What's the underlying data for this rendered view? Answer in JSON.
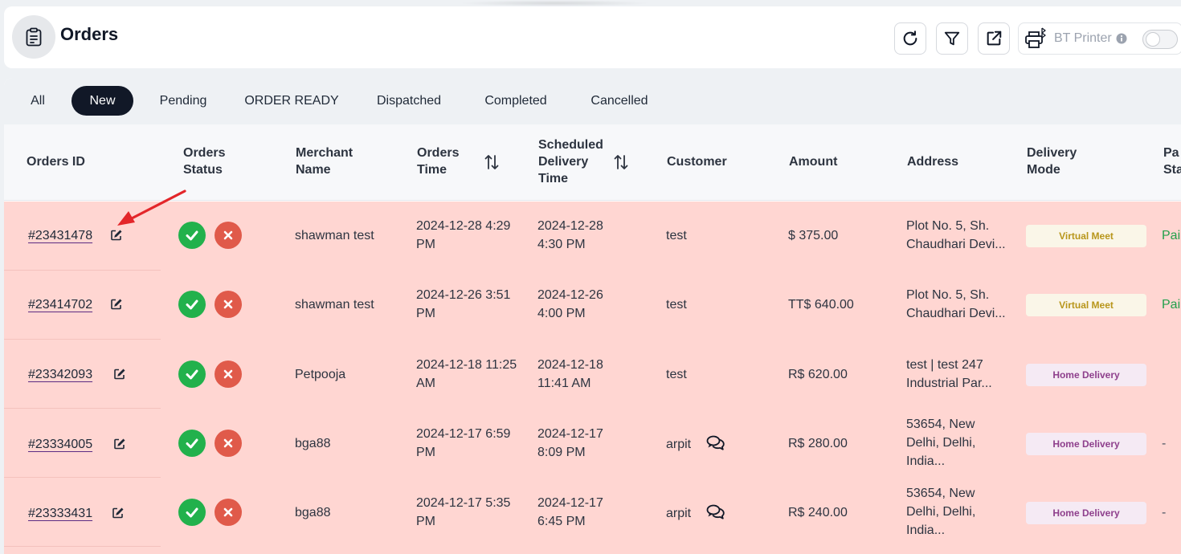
{
  "header": {
    "title": "Orders",
    "printer_label": "BT Printer"
  },
  "tabs": [
    {
      "label": "All",
      "active": false
    },
    {
      "label": "New",
      "active": true
    },
    {
      "label": "Pending",
      "active": false
    },
    {
      "label": "ORDER READY",
      "active": false
    },
    {
      "label": "Dispatched",
      "active": false
    },
    {
      "label": "Completed",
      "active": false
    },
    {
      "label": "Cancelled",
      "active": false
    }
  ],
  "columns": {
    "order_id": "Orders ID",
    "status_l1": "Orders",
    "status_l2": "Status",
    "merchant_l1": "Merchant",
    "merchant_l2": "Name",
    "time_l1": "Orders",
    "time_l2": "Time",
    "sched_l1": "Scheduled",
    "sched_l2": "Delivery",
    "sched_l3": "Time",
    "customer": "Customer",
    "amount": "Amount",
    "address": "Address",
    "mode_l1": "Delivery",
    "mode_l2": "Mode",
    "pay_l1": "Pa",
    "pay_l2": "Sta"
  },
  "rows": [
    {
      "id": "#23431478",
      "merchant": "shawman test",
      "time_l1": "2024-12-28 4:29",
      "time_l2": "PM",
      "sched_l1": "2024-12-28",
      "sched_l2": "4:30 PM",
      "customer": "test",
      "amount": "$ 375.00",
      "addr_l1": "Plot No. 5, Sh.",
      "addr_l2": "Chaudhari Devi...",
      "addr_l3": "",
      "mode": "Virtual Meet",
      "pay": "Pai"
    },
    {
      "id": "#23414702",
      "merchant": "shawman test",
      "time_l1": "2024-12-26 3:51",
      "time_l2": "PM",
      "sched_l1": "2024-12-26",
      "sched_l2": "4:00 PM",
      "customer": "test",
      "amount": "TT$ 640.00",
      "addr_l1": "Plot No. 5, Sh.",
      "addr_l2": "Chaudhari Devi...",
      "addr_l3": "",
      "mode": "Virtual Meet",
      "pay": "Pai"
    },
    {
      "id": "#23342093",
      "merchant": "Petpooja",
      "time_l1": "2024-12-18 11:25",
      "time_l2": "AM",
      "sched_l1": "2024-12-18",
      "sched_l2": "11:41 AM",
      "customer": "test",
      "amount": "R$ 620.00",
      "addr_l1": "test | test 247",
      "addr_l2": "Industrial Par...",
      "addr_l3": "",
      "mode": "Home Delivery",
      "pay": ""
    },
    {
      "id": "#23334005",
      "merchant": "bga88",
      "time_l1": "2024-12-17 6:59",
      "time_l2": "PM",
      "sched_l1": "2024-12-17",
      "sched_l2": "8:09 PM",
      "customer": "arpit",
      "amount": "R$ 280.00",
      "addr_l1": "53654, New",
      "addr_l2": "Delhi, Delhi,",
      "addr_l3": "India...",
      "mode": "Home Delivery",
      "pay": "-"
    },
    {
      "id": "#23333431",
      "merchant": "bga88",
      "time_l1": "2024-12-17 5:35",
      "time_l2": "PM",
      "sched_l1": "2024-12-17",
      "sched_l2": "6:45 PM",
      "customer": "arpit",
      "amount": "R$ 240.00",
      "addr_l1": "53654, New",
      "addr_l2": "Delhi, Delhi,",
      "addr_l3": "India...",
      "mode": "Home Delivery",
      "pay": "-"
    }
  ]
}
